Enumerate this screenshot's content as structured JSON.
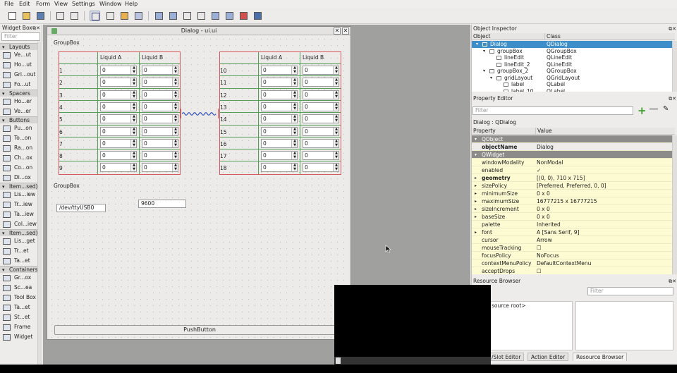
{
  "menu": [
    "File",
    "Edit",
    "Form",
    "View",
    "Settings",
    "Window",
    "Help"
  ],
  "widget_box": {
    "title": "Widget Box",
    "filter_placeholder": "Filter",
    "categories": [
      {
        "name": "Layouts",
        "items": [
          "Ve...ut",
          "Ho...ut",
          "Gri...out",
          "Fo...ut"
        ]
      },
      {
        "name": "Spacers",
        "items": [
          "Ho...er",
          "Ve...er"
        ]
      },
      {
        "name": "Buttons",
        "items": [
          "Pu...on",
          "To...on",
          "Ra...on",
          "Ch...ox",
          "Co...on",
          "Di...ox"
        ]
      },
      {
        "name": "Item...sed)",
        "items": [
          "Lis...iew",
          "Tr...iew",
          "Ta...iew",
          "Col...iew"
        ]
      },
      {
        "name": "Item...sed)",
        "items": [
          "Lis...get",
          "Tr...et",
          "Ta...et"
        ]
      },
      {
        "name": "Containers",
        "items": [
          "Gr...ox",
          "Sc...ea",
          "Tool Box",
          "Ta...et",
          "St...et",
          "Frame",
          "Widget"
        ]
      }
    ]
  },
  "dialog": {
    "title": "Dialog - ui.ui",
    "groupbox1_label": "GroupBox",
    "groupbox2_label": "GroupBox",
    "col_a": "Liquid A",
    "col_b": "Liquid B",
    "left_rows": [
      "1",
      "2",
      "3",
      "4",
      "5",
      "6",
      "7",
      "8",
      "9"
    ],
    "right_rows": [
      "10",
      "11",
      "12",
      "13",
      "14",
      "15",
      "16",
      "17",
      "18"
    ],
    "spin_value": "0",
    "port_value": "/dev/ttyUSB0",
    "baud_value": "9600",
    "push_button": "PushButton"
  },
  "object_inspector": {
    "title": "Object Inspector",
    "col_object": "Object",
    "col_class": "Class",
    "rows": [
      {
        "obj": "Dialog",
        "cls": "QDialog",
        "indent": 0,
        "selected": true
      },
      {
        "obj": "groupBox",
        "cls": "QGroupBox",
        "indent": 1,
        "selected": false
      },
      {
        "obj": "lineEdit",
        "cls": "QLineEdit",
        "indent": 2,
        "selected": false
      },
      {
        "obj": "lineEdit_2",
        "cls": "QLineEdit",
        "indent": 2,
        "selected": false
      },
      {
        "obj": "groupBox_2",
        "cls": "QGroupBox",
        "indent": 1,
        "selected": false
      },
      {
        "obj": "gridLayout",
        "cls": "QGridLayout",
        "indent": 2,
        "selected": false
      },
      {
        "obj": "label",
        "cls": "QLabel",
        "indent": 3,
        "selected": false
      },
      {
        "obj": "label_10",
        "cls": "QLabel",
        "indent": 3,
        "selected": false
      }
    ]
  },
  "property_editor": {
    "title": "Property Editor",
    "filter_placeholder": "Filter",
    "context": "Dialog : QDialog",
    "col_property": "Property",
    "col_value": "Value",
    "rows": [
      {
        "name": "QObject",
        "value": "",
        "kind": "group"
      },
      {
        "name": "objectName",
        "value": "Dialog",
        "kind": "bold"
      },
      {
        "name": "QWidget",
        "value": "",
        "kind": "group"
      },
      {
        "name": "windowModality",
        "value": "NonModal",
        "kind": "yel"
      },
      {
        "name": "enabled",
        "value": "✓",
        "kind": "yel"
      },
      {
        "name": "geometry",
        "value": "[(0, 0), 710 x 715]",
        "kind": "boldyel"
      },
      {
        "name": "sizePolicy",
        "value": "[Preferred, Preferred, 0, 0]",
        "kind": "yel"
      },
      {
        "name": "minimumSize",
        "value": "0 x 0",
        "kind": "yel"
      },
      {
        "name": "maximumSize",
        "value": "16777215 x 16777215",
        "kind": "yel"
      },
      {
        "name": "sizeIncrement",
        "value": "0 x 0",
        "kind": "yel"
      },
      {
        "name": "baseSize",
        "value": "0 x 0",
        "kind": "yel"
      },
      {
        "name": "palette",
        "value": "Inherited",
        "kind": "yel"
      },
      {
        "name": "font",
        "value": "A  [Sans Serif, 9]",
        "kind": "yel"
      },
      {
        "name": "cursor",
        "value": "Arrow",
        "kind": "yel"
      },
      {
        "name": "mouseTracking",
        "value": "☐",
        "kind": "yel"
      },
      {
        "name": "focusPolicy",
        "value": "NoFocus",
        "kind": "yel"
      },
      {
        "name": "contextMenuPolicy",
        "value": "DefaultContextMenu",
        "kind": "yel"
      },
      {
        "name": "acceptDrops",
        "value": "☐",
        "kind": "yel"
      }
    ]
  },
  "resource_browser": {
    "title": "Resource Browser",
    "filter_placeholder": "Filter",
    "root": "source root>",
    "tabs": [
      "/Slot Editor",
      "Action Editor",
      "Resource Browser"
    ]
  },
  "colors": {
    "selection": "#3d8ec9",
    "layout_red": "#d8595b",
    "layout_green": "#55a058"
  }
}
